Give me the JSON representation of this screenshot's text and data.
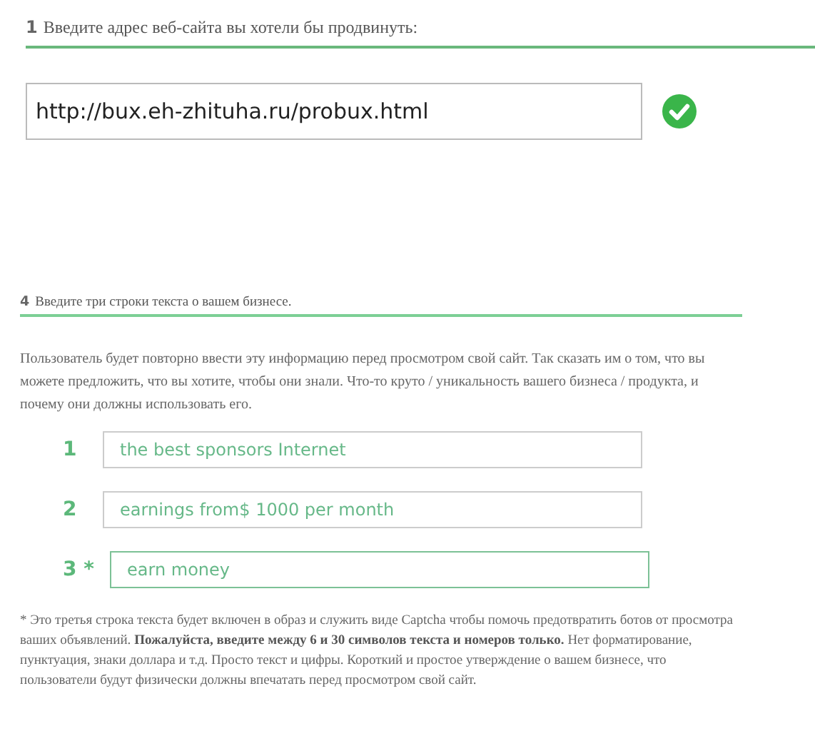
{
  "site_section": {
    "number": "1",
    "title": "Введите адрес веб-сайта вы хотели бы продвинуть:",
    "url": "http://bux.eh-zhituha.ru/probux.html",
    "valid": true
  },
  "text_section": {
    "number": "4",
    "title": "Введите три строки текста о вашем бизнесе.",
    "description": "Пользователь будет повторно ввести эту информацию перед просмотром свой сайт. Так сказать им о том, что вы можете предложить, что вы хотите, чтобы они знали. Что-то круто / уникальность вашего бизнеса / продукта, и почему они должны использовать его.",
    "lines": [
      {
        "label": "1",
        "value": "the best sponsors Internet",
        "focused": false
      },
      {
        "label": "2",
        "value": "earnings from$ 1000 per month",
        "focused": false
      },
      {
        "label": "3 *",
        "value": "earn money",
        "focused": true
      }
    ],
    "footnote": "* Это третья строка текста будет включен в образ и служить виде Captcha чтобы помочь предотвратить ботов от просмотра ваших объявлений. **Пожалуйста, введите между 6 и 30 символов текста и номеров только.** Нет форматирование, пунктуация, знаки доллара и т.д. Просто текст и цифры. Короткий и простое утверждение о вашем бизнесе, что пользователи будут физически должны впечатать перед просмотром свой сайт."
  }
}
